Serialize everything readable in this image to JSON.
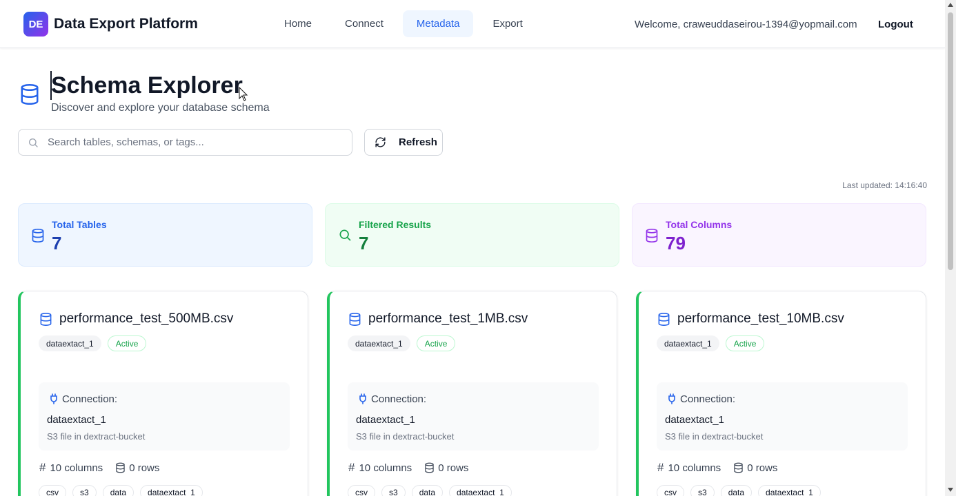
{
  "header": {
    "logo_text": "DE",
    "brand": "Data Export Platform",
    "nav": [
      {
        "label": "Home"
      },
      {
        "label": "Connect"
      },
      {
        "label": "Metadata"
      },
      {
        "label": "Export"
      }
    ],
    "active_nav": "Metadata",
    "welcome": "Welcome, craweuddaseirou-1394@yopmail.com",
    "logout": "Logout"
  },
  "page": {
    "title": "Schema Explorer",
    "subtitle": "Discover and explore your database schema",
    "icon": "database-icon"
  },
  "search": {
    "placeholder": "Search tables, schemas, or tags...",
    "value": ""
  },
  "refresh_label": "Refresh",
  "last_updated": "Last updated: 14:16:40",
  "stats": [
    {
      "label": "Total Tables",
      "value": "7",
      "icon": "database-icon",
      "color": "#2563eb"
    },
    {
      "label": "Filtered Results",
      "value": "7",
      "icon": "search-icon",
      "color": "#16a34a"
    },
    {
      "label": "Total Columns",
      "value": "79",
      "icon": "database-icon",
      "color": "#9333ea"
    }
  ],
  "tables": [
    {
      "name": "performance_test_500MB.csv",
      "schema": "dataextact_1",
      "status": "Active",
      "connection_label": "Connection:",
      "connection_name": "dataextact_1",
      "connection_desc": "S3 file in dextract-bucket",
      "columns": "10 columns",
      "rows": "0 rows",
      "tags": [
        "csv",
        "s3",
        "data",
        "dataextact_1"
      ]
    },
    {
      "name": "performance_test_1MB.csv",
      "schema": "dataextact_1",
      "status": "Active",
      "connection_label": "Connection:",
      "connection_name": "dataextact_1",
      "connection_desc": "S3 file in dextract-bucket",
      "columns": "10 columns",
      "rows": "0 rows",
      "tags": [
        "csv",
        "s3",
        "data",
        "dataextact_1"
      ]
    },
    {
      "name": "performance_test_10MB.csv",
      "schema": "dataextact_1",
      "status": "Active",
      "connection_label": "Connection:",
      "connection_name": "dataextact_1",
      "connection_desc": "S3 file in dextract-bucket",
      "columns": "10 columns",
      "rows": "0 rows",
      "tags": [
        "csv",
        "s3",
        "data",
        "dataextact_1"
      ]
    }
  ],
  "colors": {
    "accent": "#2563eb",
    "active_green": "#22c55e"
  }
}
